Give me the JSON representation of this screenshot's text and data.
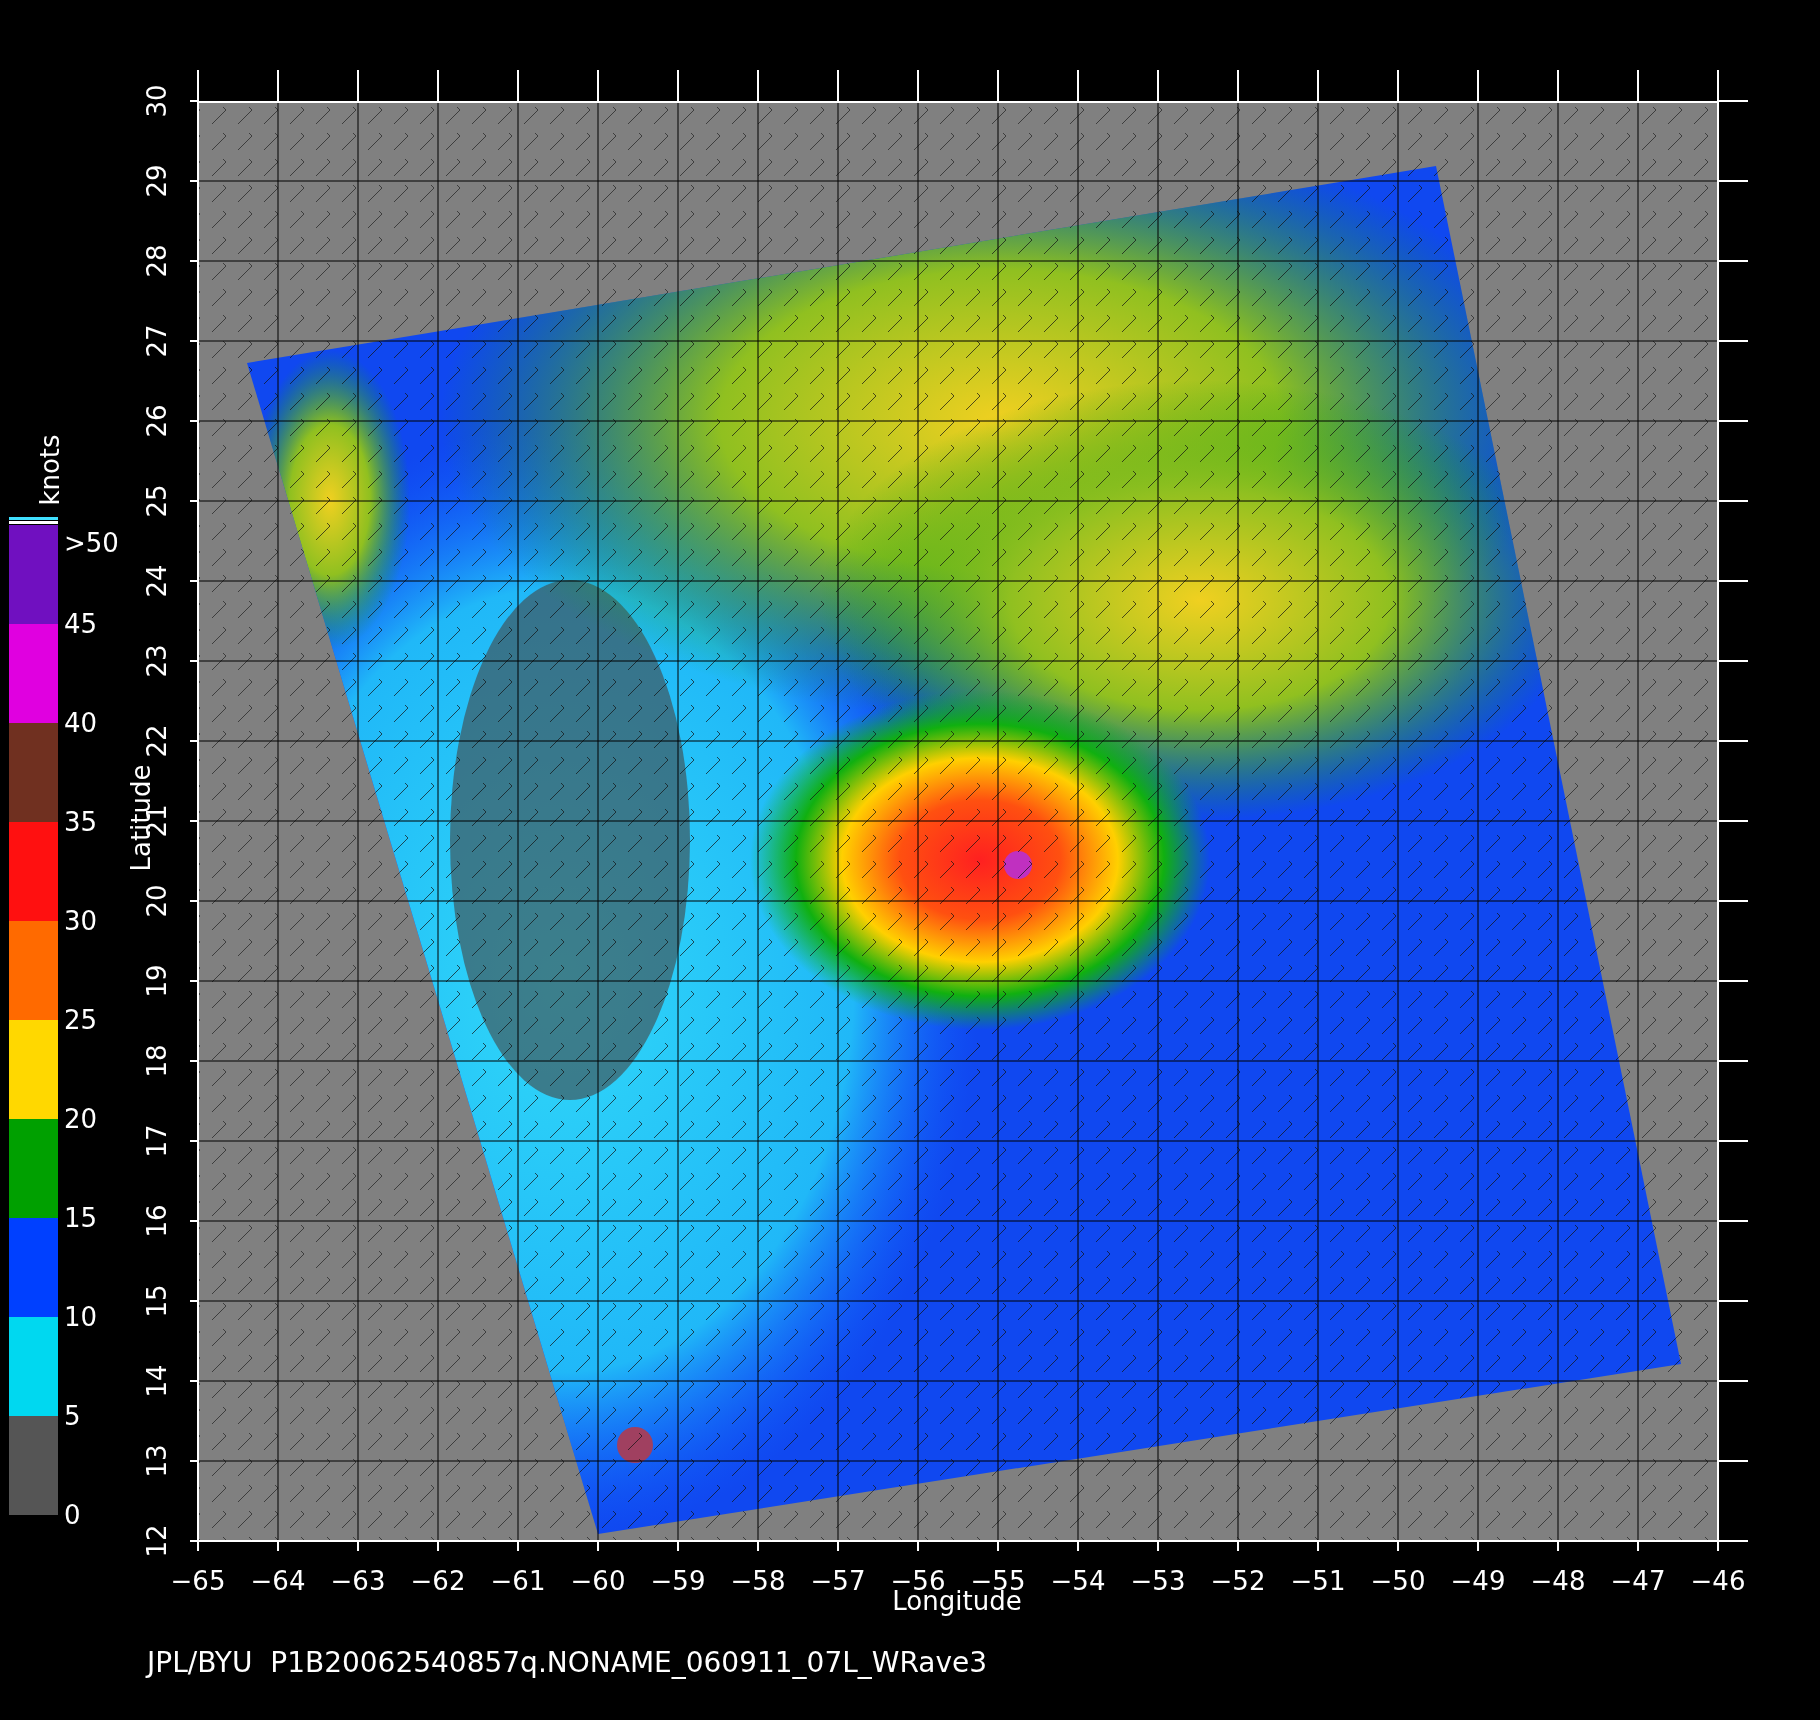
{
  "colorbar": {
    "label": "knots",
    "ticks": [
      ">50",
      "45",
      "40",
      "35",
      "30",
      "25",
      "20",
      "15",
      "10",
      "5",
      "0"
    ],
    "segments": [
      {
        "color": "#7010c0"
      },
      {
        "color": "#e000e0"
      },
      {
        "color": "#703020"
      },
      {
        "color": "#ff1010"
      },
      {
        "color": "#ff6a00"
      },
      {
        "color": "#ffd800"
      },
      {
        "color": "#00a000"
      },
      {
        "color": "#0040ff"
      },
      {
        "color": "#00d8f0"
      },
      {
        "color": "#555555"
      }
    ]
  },
  "plot": {
    "xlabel": "Longitude",
    "ylabel": "Latitude",
    "xticks": [
      "−65",
      "−64",
      "−63",
      "−62",
      "−61",
      "−60",
      "−59",
      "−58",
      "−57",
      "−56",
      "−55",
      "−54",
      "−53",
      "−52",
      "−51",
      "−50",
      "−49",
      "−48",
      "−47",
      "−46"
    ],
    "yticks": [
      "12",
      "13",
      "14",
      "15",
      "16",
      "17",
      "18",
      "19",
      "20",
      "21",
      "22",
      "23",
      "24",
      "25",
      "26",
      "27",
      "28",
      "29",
      "30"
    ]
  },
  "footer": "JPL/BYU  P1B20062540857q.NONAME_060911_07L_WRave3"
}
